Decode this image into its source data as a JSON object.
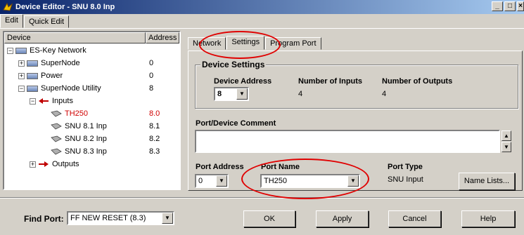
{
  "window": {
    "title": "Device Editor - SNU 8.0 Inp"
  },
  "main_tabs": [
    {
      "label": "Edit"
    },
    {
      "label": "Quick Edit"
    }
  ],
  "tree": {
    "columns": {
      "device": "Device",
      "address": "Address"
    },
    "rows": [
      {
        "label": "ES-Key Network",
        "address": ""
      },
      {
        "label": "SuperNode",
        "address": "0"
      },
      {
        "label": "Power",
        "address": "0"
      },
      {
        "label": "SuperNode Utility",
        "address": "8"
      },
      {
        "label": "Inputs",
        "address": ""
      },
      {
        "label": "TH250",
        "address": "8.0"
      },
      {
        "label": "SNU 8.1 Inp",
        "address": "8.1"
      },
      {
        "label": "SNU 8.2 Inp",
        "address": "8.2"
      },
      {
        "label": "SNU 8.3 Inp",
        "address": "8.3"
      },
      {
        "label": "Outputs",
        "address": ""
      }
    ]
  },
  "right_tabs": [
    {
      "label": "Network"
    },
    {
      "label": "Settings"
    },
    {
      "label": "Program Port"
    }
  ],
  "device_settings": {
    "title": "Device Settings",
    "device_address_label": "Device Address",
    "device_address_value": "8",
    "num_inputs_label": "Number of Inputs",
    "num_inputs_value": "4",
    "num_outputs_label": "Number of Outputs",
    "num_outputs_value": "4"
  },
  "comment": {
    "label": "Port/Device Comment",
    "value": ""
  },
  "port": {
    "address_label": "Port Address",
    "address_value": "0",
    "name_label": "Port Name",
    "name_value": "TH250",
    "type_label": "Port Type",
    "type_value": "SNU Input",
    "name_lists_button": "Name Lists..."
  },
  "bottom": {
    "find_port_label": "Find Port:",
    "find_port_value": "FF NEW RESET  (8.3)",
    "ok": "OK",
    "apply": "Apply",
    "cancel": "Cancel",
    "help": "Help"
  },
  "colors": {
    "title_start": "#0a246a",
    "title_end": "#a6caf0",
    "annotation": "#e00000",
    "selected_text": "#d00000"
  }
}
